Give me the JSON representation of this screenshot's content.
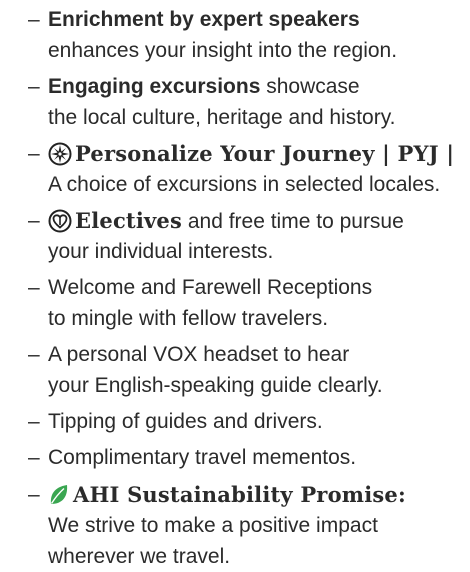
{
  "items": [
    {
      "dash": "–",
      "bold": "Enrichment by expert speakers",
      "rest": "",
      "line2": "enhances your insight into the region."
    },
    {
      "dash": "–",
      "bold": "Engaging excursions",
      "rest": " showcase",
      "line2": "the local culture, heritage and history."
    },
    {
      "dash": "–",
      "bold": "Personalize Your Journey | PYJ |",
      "rest": "",
      "line2": "A choice of excursions in selected locales."
    },
    {
      "dash": "–",
      "bold": "Electives",
      "rest": " and free time to pursue",
      "line2": "your individual interests."
    },
    {
      "dash": "–",
      "bold": "",
      "rest": "Welcome and Farewell Receptions",
      "line2": "to mingle with fellow travelers."
    },
    {
      "dash": "–",
      "bold": "",
      "rest": "A personal VOX headset to hear",
      "line2": "your English-speaking guide clearly."
    },
    {
      "dash": "–",
      "bold": "",
      "rest": "Tipping of guides and drivers.",
      "line2": ""
    },
    {
      "dash": "–",
      "bold": "",
      "rest": "Complimentary travel mementos.",
      "line2": ""
    },
    {
      "dash": "–",
      "bold": "AHI Sustainability Promise:",
      "rest": "",
      "line2": "We strive to make a positive impact",
      "line3": "wherever we travel."
    }
  ],
  "colors": {
    "text": "#2b2b2b",
    "leaf": "#3aa651"
  },
  "icons": {
    "pyj": "compass-star-icon",
    "electives": "compass-heart-icon",
    "sustainability": "leaf-icon"
  }
}
